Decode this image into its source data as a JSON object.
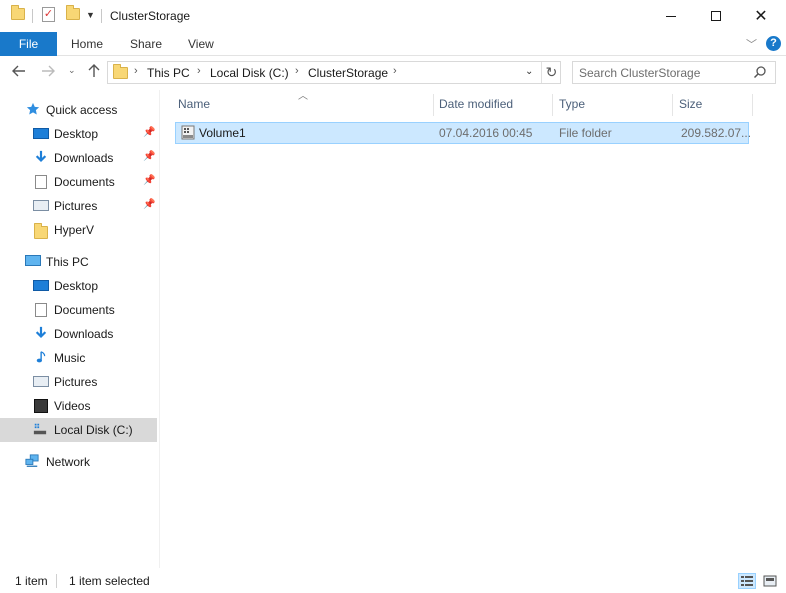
{
  "window": {
    "title": "ClusterStorage"
  },
  "ribbon": {
    "file_label": "File",
    "tabs": [
      "Home",
      "Share",
      "View"
    ]
  },
  "address": {
    "segments": [
      "This PC",
      "Local Disk (C:)",
      "ClusterStorage"
    ]
  },
  "search": {
    "placeholder": "Search ClusterStorage"
  },
  "sidebar": {
    "quick_access": "Quick access",
    "quick_items": [
      {
        "label": "Desktop",
        "icon": "desktop-icon",
        "pinned": true
      },
      {
        "label": "Downloads",
        "icon": "downloads-icon",
        "pinned": true
      },
      {
        "label": "Documents",
        "icon": "documents-icon",
        "pinned": true
      },
      {
        "label": "Pictures",
        "icon": "pictures-icon",
        "pinned": true
      },
      {
        "label": "HyperV",
        "icon": "folder-icon",
        "pinned": false
      }
    ],
    "this_pc": "This PC",
    "pc_items": [
      {
        "label": "Desktop",
        "icon": "desktop-icon"
      },
      {
        "label": "Documents",
        "icon": "documents-icon"
      },
      {
        "label": "Downloads",
        "icon": "downloads-icon"
      },
      {
        "label": "Music",
        "icon": "music-icon"
      },
      {
        "label": "Pictures",
        "icon": "pictures-icon"
      },
      {
        "label": "Videos",
        "icon": "videos-icon"
      },
      {
        "label": "Local Disk (C:)",
        "icon": "disk-icon",
        "selected": true
      }
    ],
    "network": "Network"
  },
  "columns": [
    "Name",
    "Date modified",
    "Type",
    "Size"
  ],
  "files": [
    {
      "name": "Volume1",
      "date_modified": "07.04.2016 00:45",
      "type": "File folder",
      "size": "209.582.07...",
      "selected": true
    }
  ],
  "status": {
    "item_count": "1 item",
    "selected_count": "1 item selected"
  },
  "colors": {
    "accent": "#1979ca",
    "selection": "#cce8ff",
    "selection_border": "#99d1ff",
    "header_text": "#4c607a"
  }
}
